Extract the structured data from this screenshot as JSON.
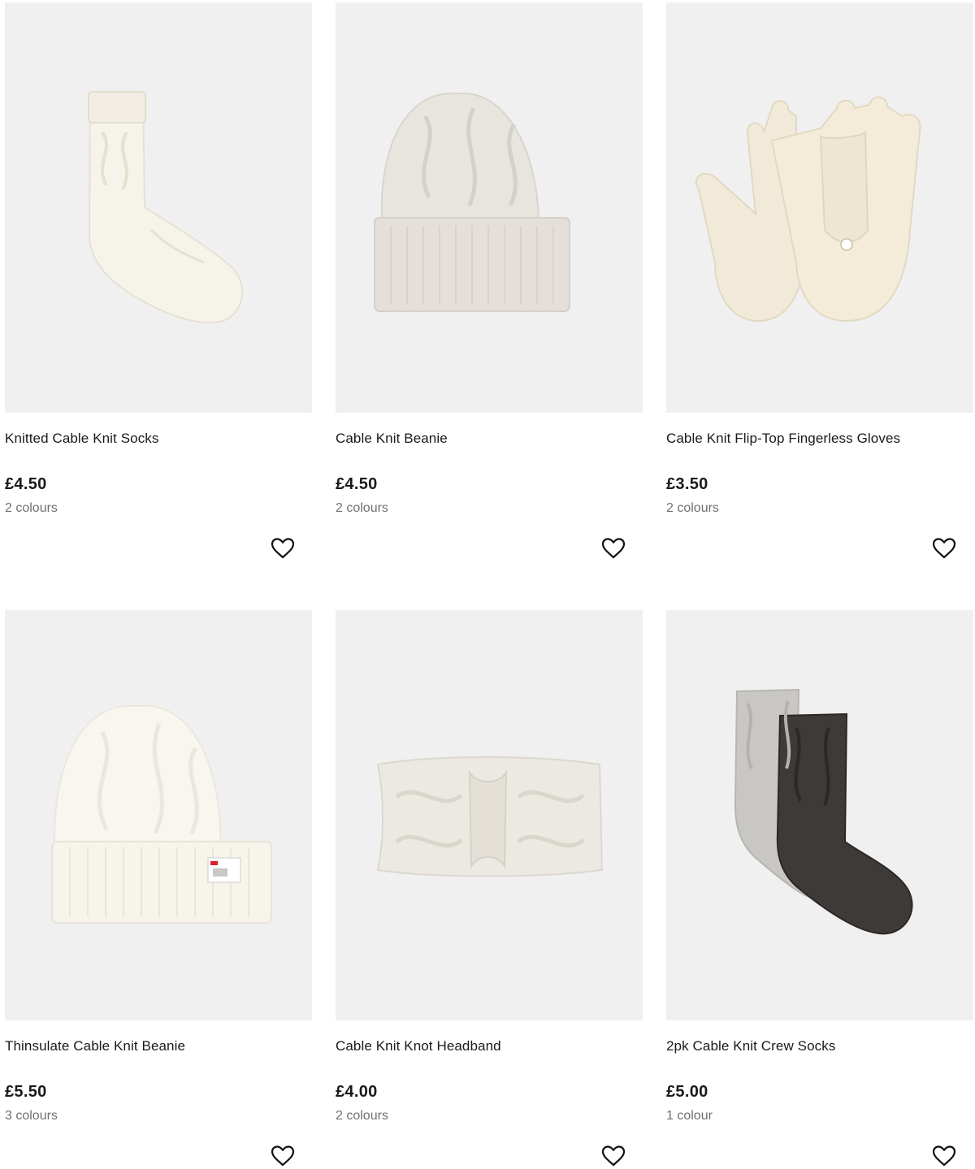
{
  "products": [
    {
      "title": "Knitted Cable Knit Socks",
      "price": "£4.50",
      "colours": "2 colours",
      "image": "cream-sock",
      "wishlist_icon": "heart-outline-icon"
    },
    {
      "title": "Cable Knit Beanie",
      "price": "£4.50",
      "colours": "2 colours",
      "image": "grey-beanie",
      "wishlist_icon": "heart-outline-icon"
    },
    {
      "title": "Cable Knit Flip-Top Fingerless Gloves",
      "price": "£3.50",
      "colours": "2 colours",
      "image": "cream-gloves",
      "wishlist_icon": "heart-outline-icon"
    },
    {
      "title": "Thinsulate Cable Knit Beanie",
      "price": "£5.50",
      "colours": "3 colours",
      "image": "white-beanie",
      "wishlist_icon": "heart-outline-icon"
    },
    {
      "title": "Cable Knit Knot Headband",
      "price": "£4.00",
      "colours": "2 colours",
      "image": "cream-headband",
      "wishlist_icon": "heart-outline-icon"
    },
    {
      "title": "2pk Cable Knit Crew Socks",
      "price": "£5.00",
      "colours": "1 colour",
      "image": "grey-charcoal-socks",
      "wishlist_icon": "heart-outline-icon"
    }
  ],
  "colors": {
    "card_background": "#f0f0f1",
    "price_text": "#1a1a1a",
    "colours_text": "#707070"
  }
}
